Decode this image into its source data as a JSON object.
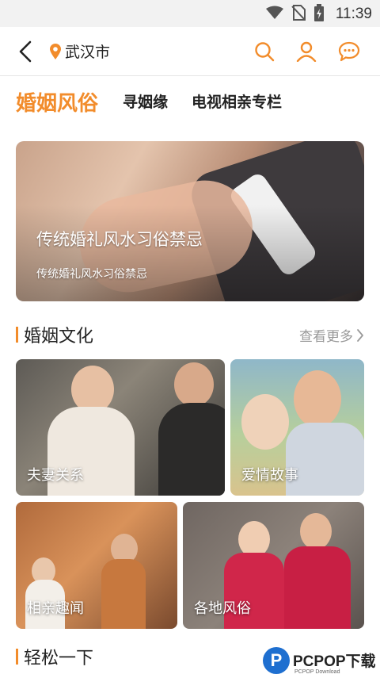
{
  "status_bar": {
    "time": "11:39"
  },
  "header": {
    "city": "武汉市"
  },
  "tabs": [
    {
      "label": "婚姻风俗",
      "active": true
    },
    {
      "label": "寻姻缘",
      "active": false
    },
    {
      "label": "电视相亲专栏",
      "active": false
    }
  ],
  "banner": {
    "title": "传统婚礼风水习俗禁忌",
    "subtitle": "传统婚礼风水习俗禁忌"
  },
  "section_culture": {
    "title": "婚姻文化",
    "more_label": "查看更多",
    "cards": [
      {
        "label": "夫妻关系"
      },
      {
        "label": "爱情故事"
      },
      {
        "label": "相亲趣闻"
      },
      {
        "label": "各地风俗"
      }
    ]
  },
  "section_relax": {
    "title": "轻松一下"
  },
  "watermark": {
    "brand": "PCPOP下载",
    "sub": "PCPOP Download"
  },
  "colors": {
    "accent": "#f28c2b",
    "text": "#222222",
    "muted": "#999999"
  }
}
